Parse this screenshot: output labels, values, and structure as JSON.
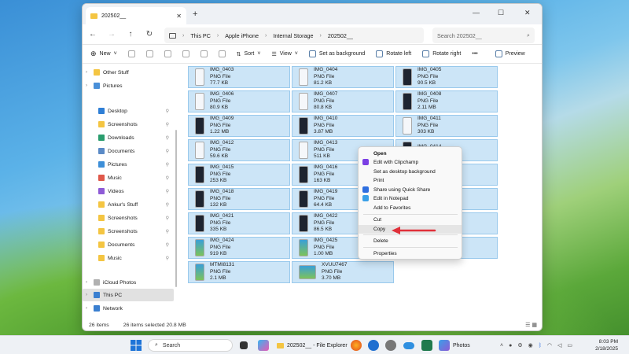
{
  "window": {
    "tab_title": "202502__",
    "new_tab": "+",
    "controls": {
      "minimize": "—",
      "maximize": "☐",
      "close": "✕"
    }
  },
  "address": {
    "segments": [
      "This PC",
      "Apple iPhone",
      "Internal Storage",
      "202502__"
    ],
    "search_placeholder": "Search 202502__"
  },
  "toolbar": {
    "new_label": "New",
    "sort_label": "Sort",
    "view_label": "View",
    "set_bg_label": "Set as background",
    "rotate_left_label": "Rotate left",
    "rotate_right_label": "Rotate right",
    "more_label": "•••",
    "preview_label": "Preview"
  },
  "sidebar": {
    "items": [
      {
        "label": "Other Stuff",
        "color": "#f4c542",
        "pinned": false,
        "chevron": true
      },
      {
        "label": "Pictures",
        "color": "#4a90d9",
        "pinned": false,
        "chevron": true
      },
      {
        "label": "Desktop",
        "color": "#2f7fd6",
        "pinned": true,
        "chevron": false
      },
      {
        "label": "Screenshots",
        "color": "#f4c542",
        "pinned": true,
        "chevron": false
      },
      {
        "label": "Downloads",
        "color": "#2a9d6e",
        "pinned": true,
        "chevron": false
      },
      {
        "label": "Documents",
        "color": "#5a8ac6",
        "pinned": true,
        "chevron": false
      },
      {
        "label": "Pictures",
        "color": "#3d8fd8",
        "pinned": true,
        "chevron": false
      },
      {
        "label": "Music",
        "color": "#e0584a",
        "pinned": true,
        "chevron": false
      },
      {
        "label": "Videos",
        "color": "#8e5bd6",
        "pinned": true,
        "chevron": false
      },
      {
        "label": "Ankur's Stuff",
        "color": "#f4c542",
        "pinned": true,
        "chevron": false
      },
      {
        "label": "Screenshots",
        "color": "#f4c542",
        "pinned": true,
        "chevron": false
      },
      {
        "label": "Screenshots",
        "color": "#f4c542",
        "pinned": true,
        "chevron": false
      },
      {
        "label": "Documents",
        "color": "#f4c542",
        "pinned": true,
        "chevron": false
      },
      {
        "label": "Music",
        "color": "#f4c542",
        "pinned": true,
        "chevron": false
      },
      {
        "label": "iCloud Photos",
        "color": "#b0b0b0",
        "pinned": false,
        "chevron": true
      },
      {
        "label": "This PC",
        "color": "#3a7fd0",
        "pinned": false,
        "chevron": true,
        "selected": true
      },
      {
        "label": "Network",
        "color": "#3a7fd0",
        "pinned": false,
        "chevron": true
      }
    ]
  },
  "files": [
    {
      "name": "IMG_0403",
      "type": "PNG File",
      "size": "77.7 KB",
      "thumb": "light"
    },
    {
      "name": "IMG_0404",
      "type": "PNG File",
      "size": "81.2 KB",
      "thumb": "light"
    },
    {
      "name": "IMG_0405",
      "type": "PNG File",
      "size": "90.5 KB",
      "thumb": "dark"
    },
    {
      "name": "IMG_0406",
      "type": "PNG File",
      "size": "80.9 KB",
      "thumb": "light"
    },
    {
      "name": "IMG_0407",
      "type": "PNG File",
      "size": "80.8 KB",
      "thumb": "light"
    },
    {
      "name": "IMG_0408",
      "type": "PNG File",
      "size": "2.11 MB",
      "thumb": "dark"
    },
    {
      "name": "IMG_0409",
      "type": "PNG File",
      "size": "1.22 MB",
      "thumb": "dark"
    },
    {
      "name": "IMG_0410",
      "type": "PNG File",
      "size": "3.87 MB",
      "thumb": "dark"
    },
    {
      "name": "IMG_0411",
      "type": "PNG File",
      "size": "303 KB",
      "thumb": "light"
    },
    {
      "name": "IMG_0412",
      "type": "PNG File",
      "size": "59.6 KB",
      "thumb": "light"
    },
    {
      "name": "IMG_0413",
      "type": "PNG File",
      "size": "511 KB",
      "thumb": "light"
    },
    {
      "name": "IMG_0414",
      "type": "PNG File",
      "size": "",
      "thumb": "dark"
    },
    {
      "name": "IMG_0415",
      "type": "PNG File",
      "size": "253 KB",
      "thumb": "dark"
    },
    {
      "name": "IMG_0416",
      "type": "PNG File",
      "size": "163 KB",
      "thumb": "dark"
    },
    {
      "name": "",
      "type": "",
      "size": "",
      "thumb": "dark"
    },
    {
      "name": "IMG_0418",
      "type": "PNG File",
      "size": "132 KB",
      "thumb": "dark"
    },
    {
      "name": "IMG_0419",
      "type": "PNG File",
      "size": "64.4 KB",
      "thumb": "dark"
    },
    {
      "name": "",
      "type": "",
      "size": "",
      "thumb": "dark"
    },
    {
      "name": "IMG_0421",
      "type": "PNG File",
      "size": "335 KB",
      "thumb": "dark"
    },
    {
      "name": "IMG_0422",
      "type": "PNG File",
      "size": "86.5 KB",
      "thumb": "dark"
    },
    {
      "name": "",
      "type": "",
      "size": "",
      "thumb": "dark"
    },
    {
      "name": "IMG_0424",
      "type": "PNG File",
      "size": "919 KB",
      "thumb": "green"
    },
    {
      "name": "IMG_0425",
      "type": "PNG File",
      "size": "1.00 MB",
      "thumb": "green"
    },
    {
      "name": "",
      "type": "",
      "size": "",
      "thumb": "dark"
    },
    {
      "name": "MTMI8131",
      "type": "PNG File",
      "size": "2.1 MB",
      "thumb": "green"
    },
    {
      "name": "XVUU7467",
      "type": "PNG File",
      "size": "3.70 MB",
      "thumb": "green"
    }
  ],
  "context_menu": {
    "items": [
      {
        "label": "Open",
        "bold": true,
        "icon": ""
      },
      {
        "label": "Edit with Clipchamp",
        "icon": "#7b3fe4"
      },
      {
        "label": "Set as desktop background",
        "icon": ""
      },
      {
        "label": "Print",
        "icon": ""
      },
      {
        "label": "Share using Quick Share",
        "icon": "#2f6fe0"
      },
      {
        "label": "Edit in Notepad",
        "icon": "#3aa0e8"
      },
      {
        "label": "Add to Favorites",
        "icon": ""
      },
      {
        "label": "Cut",
        "icon": ""
      },
      {
        "label": "Copy",
        "icon": "",
        "highlighted": true
      },
      {
        "label": "Delete",
        "icon": ""
      },
      {
        "label": "Properties",
        "icon": ""
      }
    ]
  },
  "status": {
    "item_count": "26 items",
    "selected": "26 items selected  20.8 MB"
  },
  "taskbar": {
    "search_label": "Search",
    "explorer_label": "202502__ - File Explorer",
    "photos_label": "Photos",
    "time": "8:03 PM",
    "date": "2/18/2025"
  },
  "colors": {
    "selection_fill": "#cce5f7",
    "selection_border": "#99c9ec",
    "arrow": "#e0303a"
  }
}
